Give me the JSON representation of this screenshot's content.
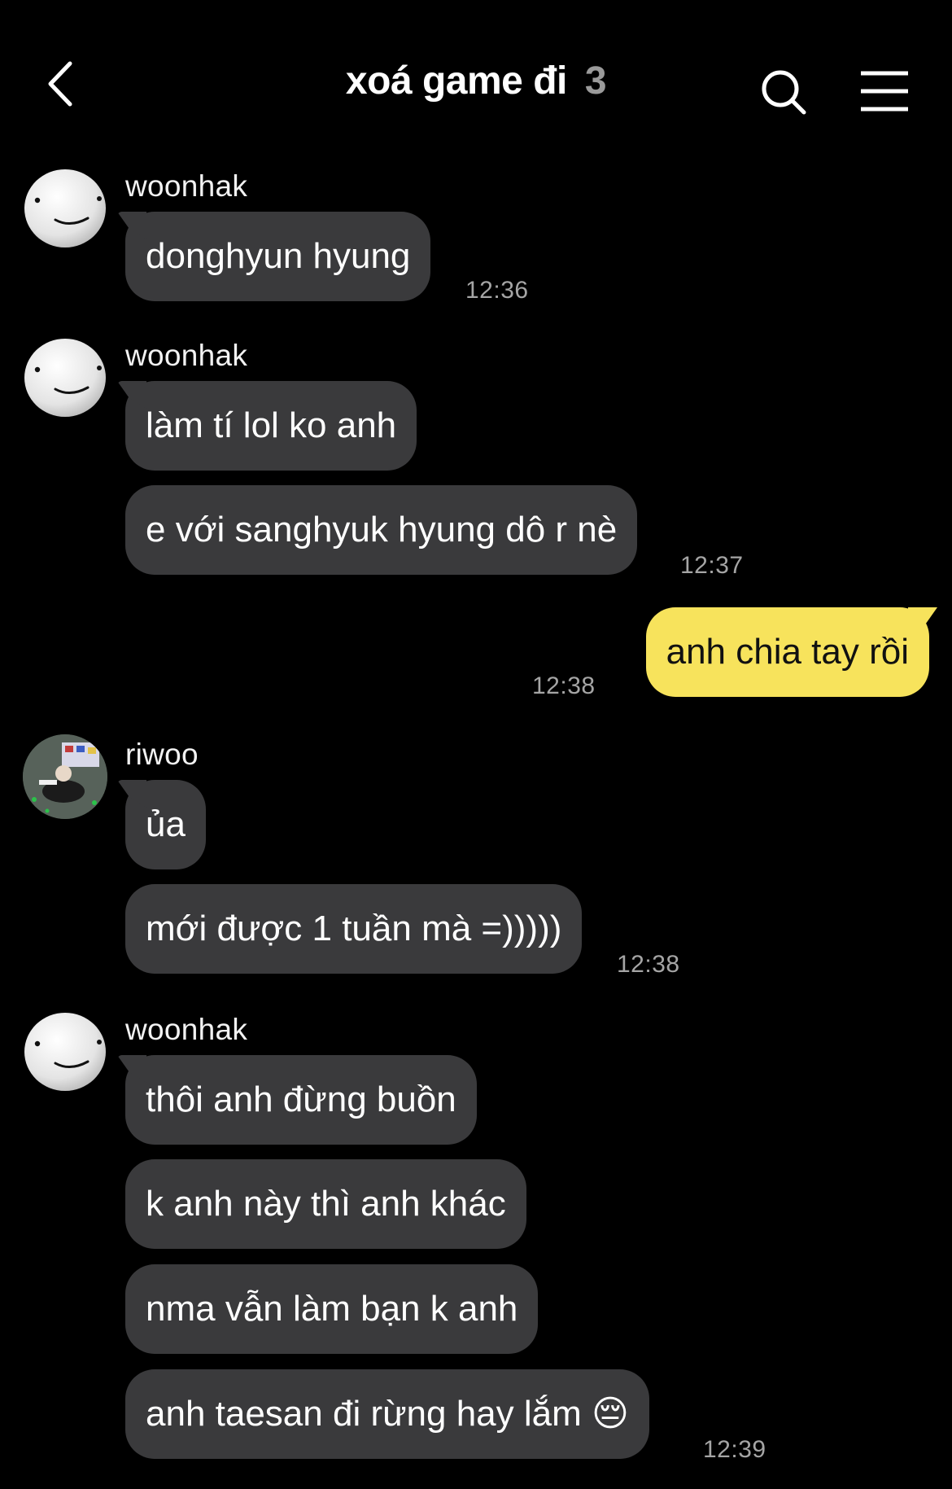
{
  "header": {
    "title": "xoá game đi",
    "member_count": "3",
    "back_icon": "chevron-left-icon",
    "search_icon": "search-icon",
    "menu_icon": "hamburger-menu-icon"
  },
  "colors": {
    "background": "#000000",
    "incoming_bubble": "#3a3a3c",
    "outgoing_bubble": "#f7e35c",
    "timestamp": "#a5a5a5"
  },
  "messages": {
    "g1": {
      "sender": "woonhak",
      "m1": "donghyun hyung",
      "time": "12:36"
    },
    "g2": {
      "sender": "woonhak",
      "m1": "làm tí lol ko anh",
      "m2": "e với sanghyuk hyung dô r nè",
      "time": "12:37"
    },
    "g3": {
      "m1": "anh chia tay rồi",
      "time": "12:38"
    },
    "g4": {
      "sender": "riwoo",
      "m1": "ủa",
      "m2": "mới được 1 tuần mà =)))))",
      "time": "12:38"
    },
    "g5": {
      "sender": "woonhak",
      "m1": "thôi anh đừng buồn",
      "m2": "k anh này thì anh khác",
      "m3": "nma vẫn làm bạn k anh",
      "m4": "anh taesan đi rừng hay lắm 😔",
      "time": "12:39"
    }
  }
}
